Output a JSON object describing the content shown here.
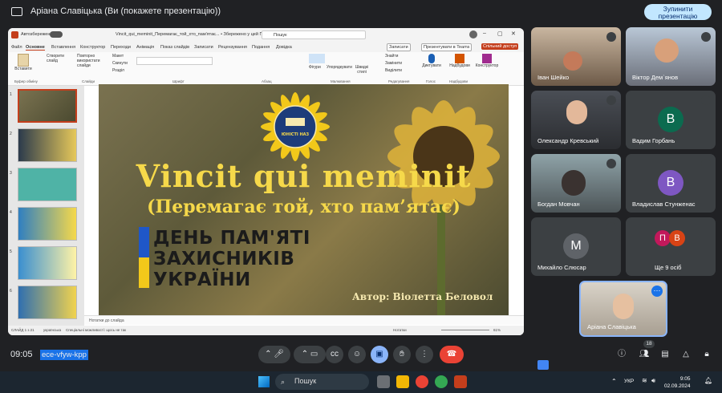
{
  "topbar": {
    "presenter": "Аріана Славіцька (Ви (покажете презентацію))",
    "stop_label": "Зупинити презентацію"
  },
  "ppt": {
    "autosave": "Автозбереження",
    "filename": "Vincit_qui_meminit_Перемагає_той_хто_пам'ятає... • Збережено у цей ПК",
    "search": "Пошук",
    "menu": [
      "Файл",
      "Основне",
      "Вставлення",
      "Конструктор",
      "Переходи",
      "Анімація",
      "Показ слайдів",
      "Записати",
      "Рецензування",
      "Подання",
      "Довідка"
    ],
    "record_label": "Записати",
    "present_teams_label": "Презентувати в Teams",
    "share_label": "Спільний доступ",
    "ribbon": [
      {
        "label": "Буфер обміну",
        "items": [
          "Вставити"
        ]
      },
      {
        "label": "Слайди",
        "items": [
          "Створити слайд",
          "Повторно використати слайди",
          "Макет",
          "Скинути",
          "Розділ"
        ]
      },
      {
        "label": "Шрифт",
        "items": []
      },
      {
        "label": "Абзац",
        "items": []
      },
      {
        "label": "Малювання",
        "items": [
          "Фігури",
          "Упорядкувати",
          "Швидкі стилі"
        ]
      },
      {
        "label": "Редагування",
        "items": [
          "Знайти",
          "Замінити",
          "Виділити"
        ]
      },
      {
        "label": "Голос",
        "items": [
          "Диктувати"
        ]
      },
      {
        "label": "Надбудови",
        "items": [
          "Надбудови"
        ]
      },
      {
        "label": "",
        "items": [
          "Конструктор"
        ]
      }
    ],
    "thumb_numbers": [
      "1",
      "2",
      "3",
      "4",
      "5",
      "6"
    ],
    "notes": "Нотатки до слайда",
    "status_slide": "СЛАЙД 1 з 21",
    "status_lang": "українська",
    "status_access": "Спеціальні можливості: щось не так",
    "status_notes": "Нотатки",
    "status_zoom": "61%"
  },
  "slide": {
    "logo_text": "ЮНІСТІ НАЗ",
    "title": "Vincit qui meminit",
    "subtitle": "(Перемагає той, хто пам’ятає)",
    "day_lines": [
      "ДЕНЬ ПАМ'ЯТІ",
      "ЗАХИСНИКІВ",
      "УКРАЇНИ"
    ],
    "author": "Автор: Віолетта Беловол"
  },
  "participants": [
    {
      "name": "Іван Шейко",
      "avatar": ""
    },
    {
      "name": "Віктор Дем`янов",
      "avatar": ""
    },
    {
      "name": "Олександр Кревський",
      "avatar": ""
    },
    {
      "name": "Вадим Горбань",
      "avatar": "В",
      "color": "#0b6b4f"
    },
    {
      "name": "Богдан Мовчан",
      "avatar": ""
    },
    {
      "name": "Владислав Стунженас",
      "avatar": "В",
      "color": "#7e57c2"
    },
    {
      "name": "Михайло Слюсар",
      "avatar": "М",
      "color": "#5f6368"
    },
    {
      "name": "Ще 9 осіб",
      "avatar": "П"
    },
    {
      "name": "Аріана Славіцька",
      "avatar": ""
    }
  ],
  "bottom": {
    "time": "09:05",
    "code": "ece-vfyw-kpp",
    "participants_count": "18"
  },
  "taskbar": {
    "search": "Пошук",
    "lang": "УКР",
    "clock_time": "9:05",
    "clock_date": "02.09.2024"
  }
}
